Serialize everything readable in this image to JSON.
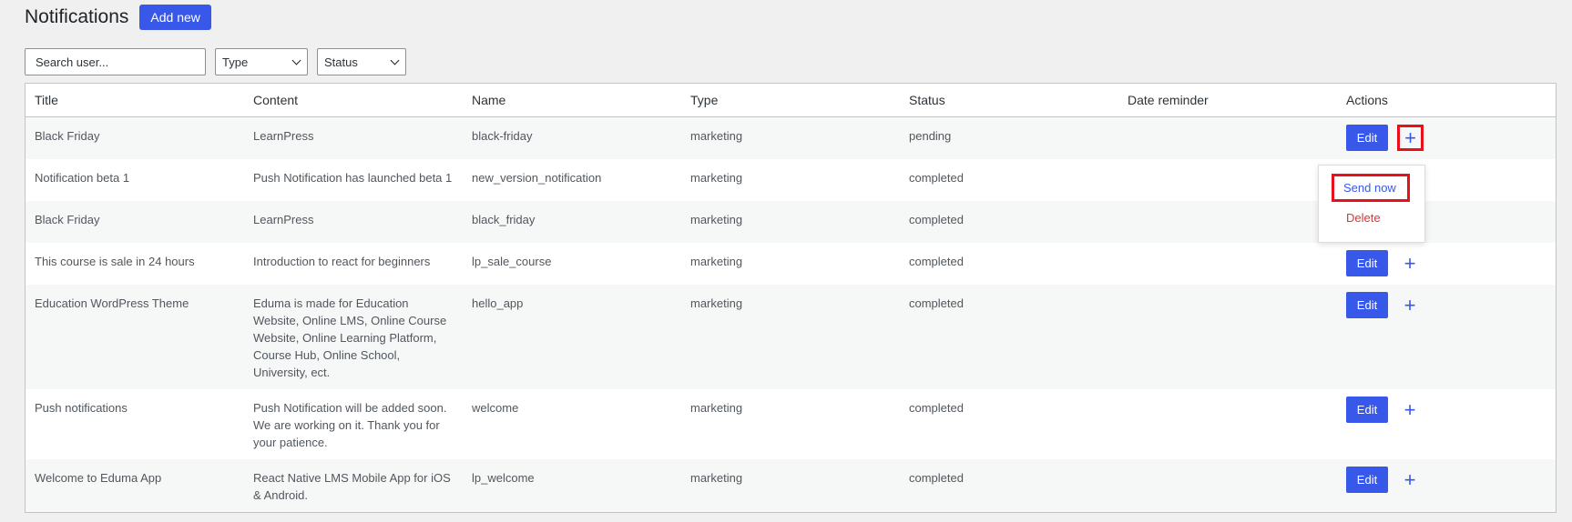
{
  "header": {
    "title": "Notifications",
    "add_new_label": "Add new"
  },
  "filters": {
    "search_placeholder": "Search user...",
    "type_label": "Type",
    "status_label": "Status"
  },
  "table": {
    "columns": [
      "Title",
      "Content",
      "Name",
      "Type",
      "Status",
      "Date reminder",
      "Actions"
    ],
    "rows": [
      {
        "title": "Black Friday",
        "content": "LearnPress",
        "name": "black-friday",
        "type": "marketing",
        "status": "pending",
        "date_reminder": ""
      },
      {
        "title": "Notification beta 1",
        "content": "Push Notification has launched beta 1",
        "name": "new_version_notification",
        "type": "marketing",
        "status": "completed",
        "date_reminder": ""
      },
      {
        "title": "Black Friday",
        "content": "LearnPress",
        "name": "black_friday",
        "type": "marketing",
        "status": "completed",
        "date_reminder": ""
      },
      {
        "title": "This course is sale in 24 hours",
        "content": "Introduction to react for beginners",
        "name": "lp_sale_course",
        "type": "marketing",
        "status": "completed",
        "date_reminder": ""
      },
      {
        "title": "Education WordPress Theme",
        "content": "Eduma is made for Education Website, Online LMS, Online Course Website, Online Learning Platform, Course Hub, Online School, University, ect.",
        "name": "hello_app",
        "type": "marketing",
        "status": "completed",
        "date_reminder": ""
      },
      {
        "title": "Push notifications",
        "content": "Push Notification will be added soon. We are working on it. Thank you for your patience.",
        "name": "welcome",
        "type": "marketing",
        "status": "completed",
        "date_reminder": ""
      },
      {
        "title": "Welcome to Eduma App",
        "content": "React Native LMS Mobile App for iOS & Android.",
        "name": "lp_welcome",
        "type": "marketing",
        "status": "completed",
        "date_reminder": ""
      }
    ],
    "edit_label": "Edit",
    "plus_glyph": "+"
  },
  "dropdown": {
    "send_now_label": "Send now",
    "delete_label": "Delete"
  },
  "colors": {
    "accent": "#3858e9",
    "highlight": "#e7101b",
    "danger": "#d63638"
  }
}
